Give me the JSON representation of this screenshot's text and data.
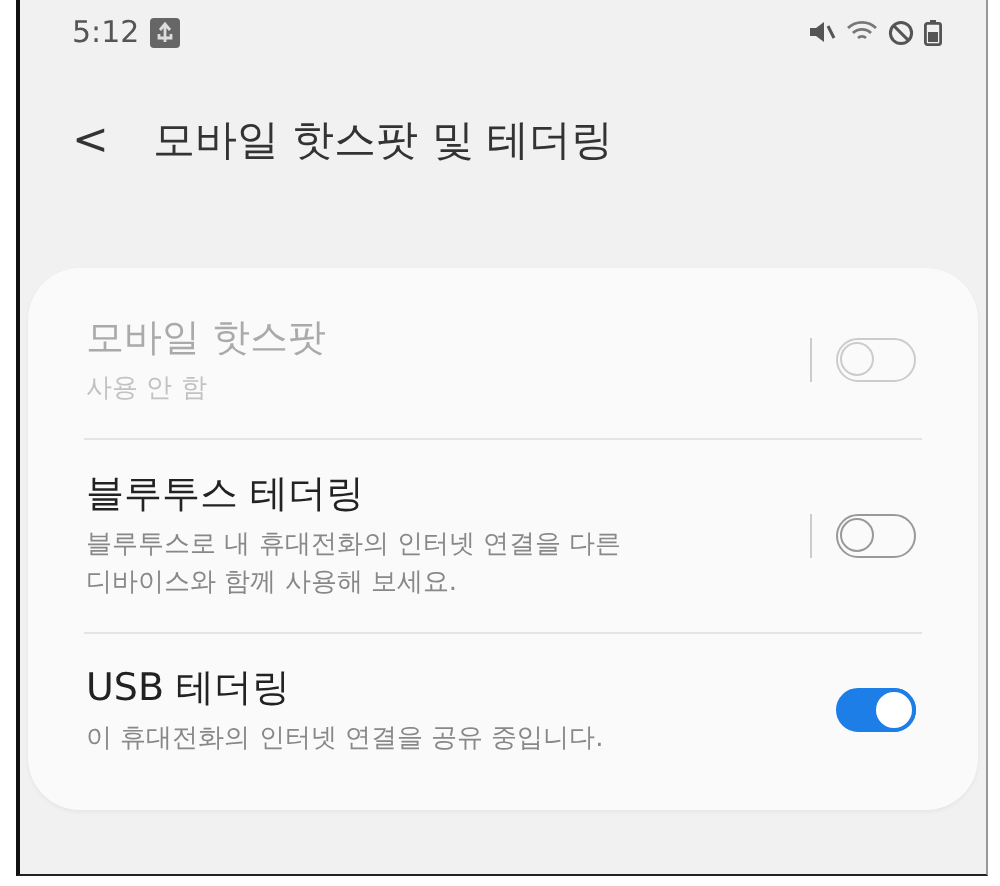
{
  "status_bar": {
    "time": "5:12"
  },
  "header": {
    "back": "<",
    "title": "모바일 핫스팟 및 테더링"
  },
  "items": [
    {
      "title": "모바일 핫스팟",
      "subtitle": "사용 안 함",
      "on": false,
      "disabled": true,
      "has_settings": true
    },
    {
      "title": "블루투스 테더링",
      "subtitle": "블루투스로 내 휴대전화의 인터넷 연결을 다른 디바이스와 함께 사용해 보세요.",
      "on": false,
      "disabled": false,
      "has_settings": true
    },
    {
      "title": "USB 테더링",
      "subtitle": "이 휴대전화의 인터넷 연결을 공유 중입니다.",
      "on": true,
      "disabled": false,
      "has_settings": false
    }
  ]
}
